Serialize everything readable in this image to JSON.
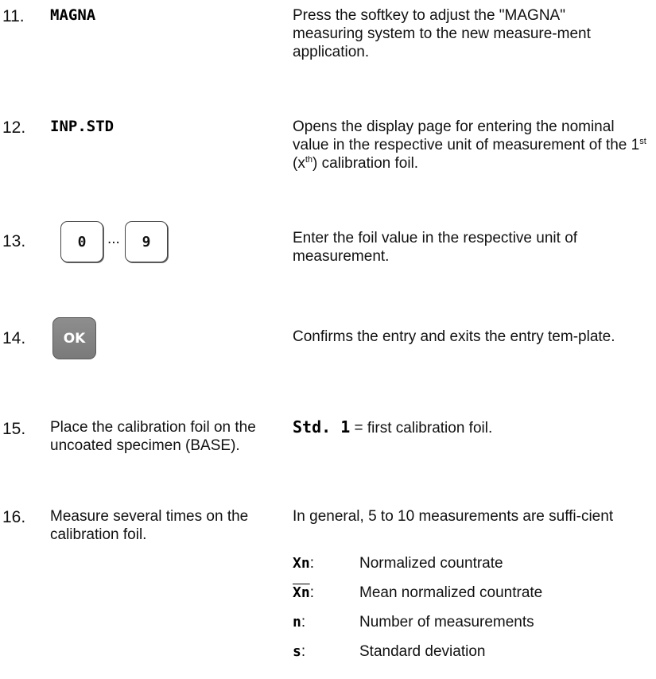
{
  "steps": [
    {
      "number": "11.",
      "softkey": "MAGNA",
      "description": "Press the softkey to adjust the \"MAGNA\" measuring system to the new measure-ment application."
    },
    {
      "number": "12.",
      "softkey": "INP.STD",
      "description_parts": {
        "a": "Opens the display page for entering the nominal value in the respective unit of measurement of the 1",
        "sup1": "st",
        "b": " (x",
        "sup2": "th",
        "c": ") calibration foil."
      }
    },
    {
      "number": "13.",
      "key_from": "0",
      "ellipsis": "...",
      "key_to": "9",
      "description": "Enter the foil value in the respective unit of measurement."
    },
    {
      "number": "14.",
      "key": "OK",
      "description": "Confirms the entry and exits the entry tem-plate."
    },
    {
      "number": "15.",
      "action": "Place the calibration foil on the uncoated specimen (BASE).",
      "display": "Std. 1",
      "description": "= first calibration foil."
    },
    {
      "number": "16.",
      "action": "Measure several times on the calibration foil.",
      "description": "In general, 5 to 10 measurements are suffi-cient",
      "symbols": [
        {
          "symbol": "Xn",
          "separator": ":",
          "meaning": "Normalized countrate"
        },
        {
          "symbol": "Xn",
          "separator": ":",
          "meaning": "Mean normalized countrate"
        },
        {
          "symbol": "n",
          "separator": ":",
          "meaning": "Number of measurements"
        },
        {
          "symbol": "s",
          "separator": ":",
          "meaning": "Standard deviation"
        }
      ]
    }
  ]
}
